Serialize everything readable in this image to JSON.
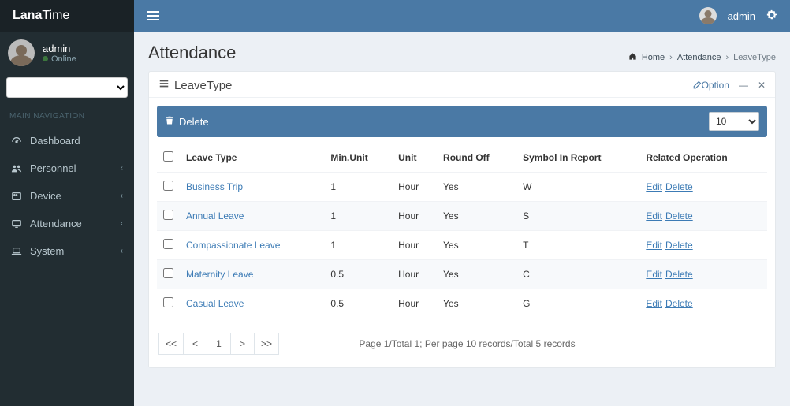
{
  "brand": {
    "bold": "Lana",
    "rest": "Time"
  },
  "user": {
    "name": "admin",
    "status": "Online"
  },
  "nav_header": "MAIN NAVIGATION",
  "nav": [
    {
      "name": "dashboard",
      "label": "Dashboard",
      "icon": "dashboard-icon",
      "has_children": false
    },
    {
      "name": "personnel",
      "label": "Personnel",
      "icon": "users-icon",
      "has_children": true
    },
    {
      "name": "device",
      "label": "Device",
      "icon": "device-icon",
      "has_children": true
    },
    {
      "name": "attendance",
      "label": "Attendance",
      "icon": "monitor-icon",
      "has_children": true
    },
    {
      "name": "system",
      "label": "System",
      "icon": "laptop-icon",
      "has_children": true
    }
  ],
  "topbar": {
    "user": "admin"
  },
  "page": {
    "title": "Attendance"
  },
  "breadcrumb": {
    "home": "Home",
    "mid": "Attendance",
    "leaf": "LeaveType"
  },
  "panel": {
    "title": "LeaveType",
    "option": "Option",
    "minimize": "—",
    "close": "✕"
  },
  "toolbar": {
    "delete": "Delete",
    "per_page": "10"
  },
  "table": {
    "headers": [
      "Leave Type",
      "Min.Unit",
      "Unit",
      "Round Off",
      "Symbol In Report",
      "Related Operation"
    ],
    "rows": [
      {
        "type": "Business Trip",
        "min": "1",
        "unit": "Hour",
        "round": "Yes",
        "symbol": "W"
      },
      {
        "type": "Annual Leave",
        "min": "1",
        "unit": "Hour",
        "round": "Yes",
        "symbol": "S"
      },
      {
        "type": "Compassionate Leave",
        "min": "1",
        "unit": "Hour",
        "round": "Yes",
        "symbol": "T"
      },
      {
        "type": "Maternity Leave",
        "min": "0.5",
        "unit": "Hour",
        "round": "Yes",
        "symbol": "C"
      },
      {
        "type": "Casual Leave",
        "min": "0.5",
        "unit": "Hour",
        "round": "Yes",
        "symbol": "G"
      }
    ],
    "ops": {
      "edit": "Edit",
      "delete": "Delete"
    }
  },
  "pager": {
    "first": "<<",
    "prev": "<",
    "current": "1",
    "next": ">",
    "last": ">>",
    "info": "Page 1/Total 1; Per page 10 records/Total 5 records"
  }
}
